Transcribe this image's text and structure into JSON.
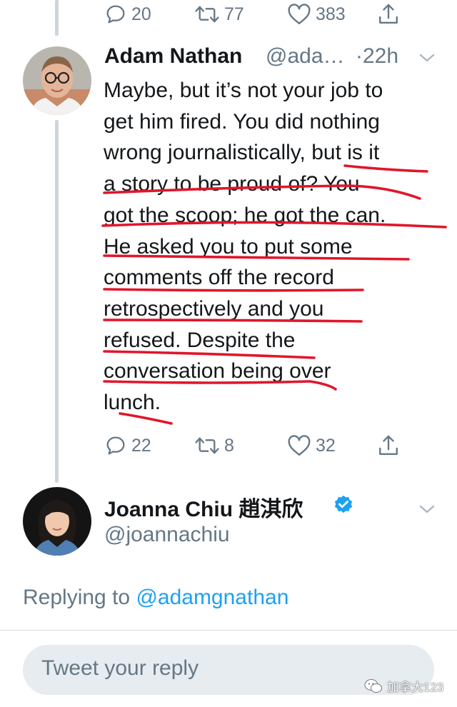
{
  "prev_tweet": {
    "actions": {
      "replies": "20",
      "retweets": "77",
      "likes": "383"
    }
  },
  "tweet": {
    "author_name": "Adam Nathan",
    "author_handle": "@ada…",
    "time": "·22h",
    "lines": [
      "Maybe, but it’s not your job to",
      "get him fired. You did nothing",
      "wrong journalistically, but is it",
      "a story to be proud of? You",
      "got the scoop; he got the can.",
      "He asked you to put some",
      "comments off the record",
      "retrospectively and you",
      "refused. Despite the",
      "conversation being over",
      "lunch."
    ],
    "actions": {
      "replies": "22",
      "retweets": "8",
      "likes": "32"
    }
  },
  "reply_author": {
    "name": "Joanna Chiu 趙淇欣",
    "handle": "@joannachiu"
  },
  "replying_to": {
    "prefix": "Replying to",
    "mention": "@adamgnathan"
  },
  "reply_box": {
    "placeholder": "Tweet your reply"
  },
  "watermark": {
    "text": "加拿大123"
  },
  "colors": {
    "accent": "#1da1f2",
    "muted": "#657786",
    "annotation": "#e0162b"
  },
  "icons": [
    "reply-icon",
    "retweet-icon",
    "like-icon",
    "share-icon",
    "chevron-down-icon",
    "verified-badge-icon"
  ]
}
